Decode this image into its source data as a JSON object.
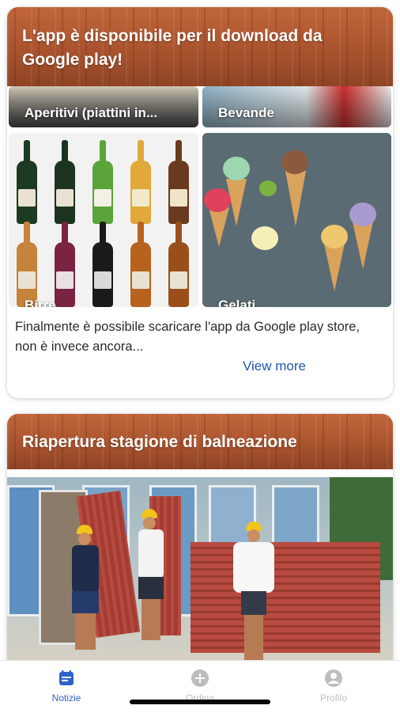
{
  "feed": {
    "card1": {
      "title": "L'app è disponibile per il download da Google play!",
      "categories": [
        {
          "label": "Aperitivi (piattini in..."
        },
        {
          "label": "Bevande"
        },
        {
          "label": "Birre"
        },
        {
          "label": "Gelati"
        }
      ],
      "excerpt": "Finalmente è possibile scaricare l'app da Google play store, non è invece ancora...",
      "link_label": "View more"
    },
    "card2": {
      "title": "Riapertura stagione di balneazione"
    }
  },
  "tabbar": {
    "tabs": [
      {
        "label": "Notizie",
        "icon": "calendar-icon",
        "active": true
      },
      {
        "label": "Ordina",
        "icon": "plus-circle-icon",
        "active": false
      },
      {
        "label": "Profilo",
        "icon": "person-circle-icon",
        "active": false
      }
    ]
  },
  "colors": {
    "accent": "#2f63c7",
    "link": "#1f56b3",
    "inactive_tab": "#bdbdbd",
    "wood_header": "#a9532e"
  }
}
